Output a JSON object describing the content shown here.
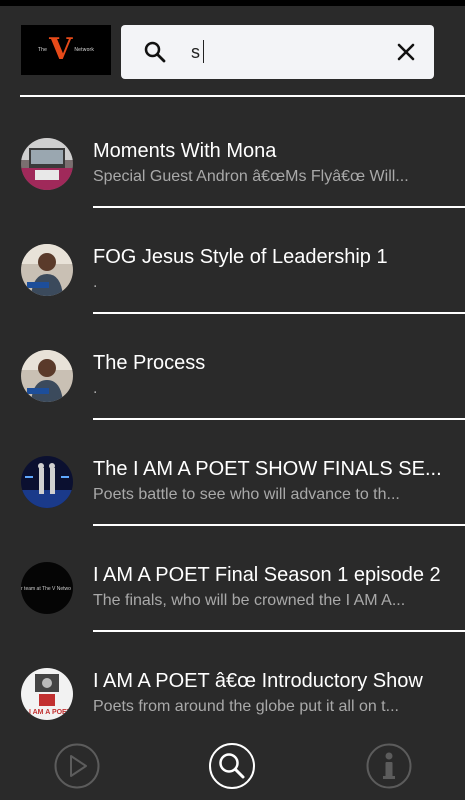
{
  "header": {
    "logo_text": "The V Network",
    "logo_letter": "V",
    "search": {
      "value": "s",
      "placeholder": ""
    }
  },
  "episodes": [
    {
      "title": "Moments With Mona",
      "subtitle": "Special Guest Andron â€œMs Flyâ€œ Will..."
    },
    {
      "title": "FOG Jesus Style of Leadership 1",
      "subtitle": "."
    },
    {
      "title": "The Process",
      "subtitle": "."
    },
    {
      "title": "The I AM A POET SHOW FINALS SE...",
      "subtitle": "Poets battle to see who will advance to th..."
    },
    {
      "title": "I AM A POET Final Season 1 episode 2",
      "subtitle": "The finals, who will be crowned the I AM A..."
    },
    {
      "title": "I AM A POET â€œ Introductory Show",
      "subtitle": "Poets from around the globe put it all on t..."
    }
  ],
  "avatar_art": {
    "item5_text": "r team at The V Netwo",
    "item6_text": "I AM A POET"
  },
  "bottom_nav": {
    "items": [
      {
        "icon": "play-icon",
        "active": false
      },
      {
        "icon": "search-icon",
        "active": true
      },
      {
        "icon": "info-icon",
        "active": false
      }
    ]
  },
  "colors": {
    "background": "#2a2a2a",
    "logo_accent": "#e64a19",
    "subtitle": "#a9a9a9",
    "nav_inactive": "#5c5c5c"
  }
}
